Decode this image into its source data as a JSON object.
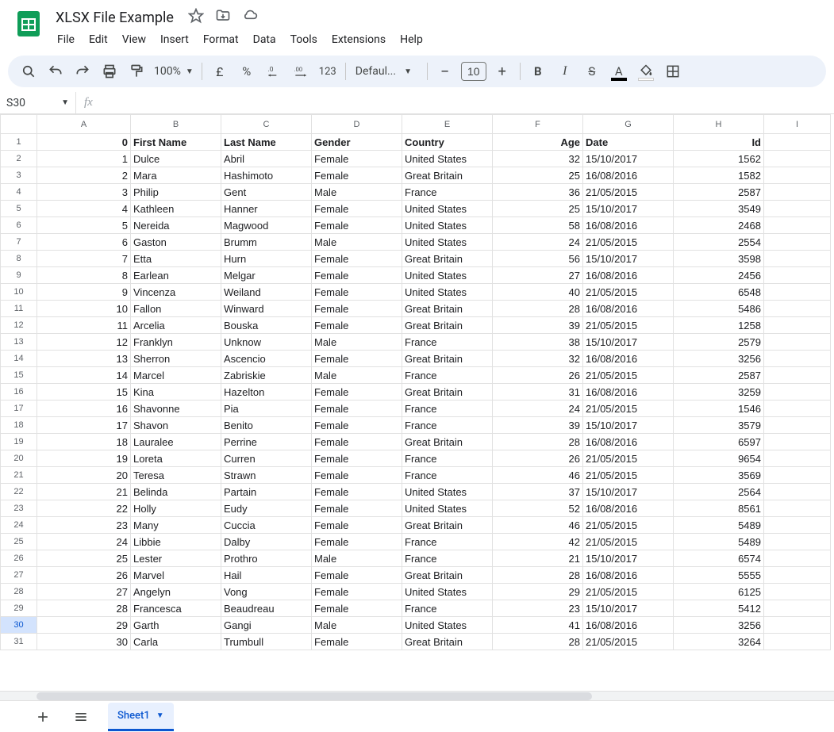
{
  "doc_title": "XLSX File Example",
  "menus": [
    "File",
    "Edit",
    "View",
    "Insert",
    "Format",
    "Data",
    "Tools",
    "Extensions",
    "Help"
  ],
  "toolbar": {
    "zoom": "100%",
    "font": "Defaul...",
    "font_size": "10",
    "currency": "£",
    "percent": "%",
    "num_format": "123"
  },
  "name_box": "S30",
  "columns": [
    "A",
    "B",
    "C",
    "D",
    "E",
    "F",
    "G",
    "H",
    "I"
  ],
  "selected_row": 30,
  "header_row": [
    "0",
    "First Name",
    "Last Name",
    "Gender",
    "Country",
    "Age",
    "Date",
    "Id"
  ],
  "rows": [
    [
      "1",
      "Dulce",
      "Abril",
      "Female",
      "United States",
      "32",
      "15/10/2017",
      "1562"
    ],
    [
      "2",
      "Mara",
      "Hashimoto",
      "Female",
      "Great Britain",
      "25",
      "16/08/2016",
      "1582"
    ],
    [
      "3",
      "Philip",
      "Gent",
      "Male",
      "France",
      "36",
      "21/05/2015",
      "2587"
    ],
    [
      "4",
      "Kathleen",
      "Hanner",
      "Female",
      "United States",
      "25",
      "15/10/2017",
      "3549"
    ],
    [
      "5",
      "Nereida",
      "Magwood",
      "Female",
      "United States",
      "58",
      "16/08/2016",
      "2468"
    ],
    [
      "6",
      "Gaston",
      "Brumm",
      "Male",
      "United States",
      "24",
      "21/05/2015",
      "2554"
    ],
    [
      "7",
      "Etta",
      "Hurn",
      "Female",
      "Great Britain",
      "56",
      "15/10/2017",
      "3598"
    ],
    [
      "8",
      "Earlean",
      "Melgar",
      "Female",
      "United States",
      "27",
      "16/08/2016",
      "2456"
    ],
    [
      "9",
      "Vincenza",
      "Weiland",
      "Female",
      "United States",
      "40",
      "21/05/2015",
      "6548"
    ],
    [
      "10",
      "Fallon",
      "Winward",
      "Female",
      "Great Britain",
      "28",
      "16/08/2016",
      "5486"
    ],
    [
      "11",
      "Arcelia",
      "Bouska",
      "Female",
      "Great Britain",
      "39",
      "21/05/2015",
      "1258"
    ],
    [
      "12",
      "Franklyn",
      "Unknow",
      "Male",
      "France",
      "38",
      "15/10/2017",
      "2579"
    ],
    [
      "13",
      "Sherron",
      "Ascencio",
      "Female",
      "Great Britain",
      "32",
      "16/08/2016",
      "3256"
    ],
    [
      "14",
      "Marcel",
      "Zabriskie",
      "Male",
      "France",
      "26",
      "21/05/2015",
      "2587"
    ],
    [
      "15",
      "Kina",
      "Hazelton",
      "Female",
      "Great Britain",
      "31",
      "16/08/2016",
      "3259"
    ],
    [
      "16",
      "Shavonne",
      "Pia",
      "Female",
      "France",
      "24",
      "21/05/2015",
      "1546"
    ],
    [
      "17",
      "Shavon",
      "Benito",
      "Female",
      "France",
      "39",
      "15/10/2017",
      "3579"
    ],
    [
      "18",
      "Lauralee",
      "Perrine",
      "Female",
      "Great Britain",
      "28",
      "16/08/2016",
      "6597"
    ],
    [
      "19",
      "Loreta",
      "Curren",
      "Female",
      "France",
      "26",
      "21/05/2015",
      "9654"
    ],
    [
      "20",
      "Teresa",
      "Strawn",
      "Female",
      "France",
      "46",
      "21/05/2015",
      "3569"
    ],
    [
      "21",
      "Belinda",
      "Partain",
      "Female",
      "United States",
      "37",
      "15/10/2017",
      "2564"
    ],
    [
      "22",
      "Holly",
      "Eudy",
      "Female",
      "United States",
      "52",
      "16/08/2016",
      "8561"
    ],
    [
      "23",
      "Many",
      "Cuccia",
      "Female",
      "Great Britain",
      "46",
      "21/05/2015",
      "5489"
    ],
    [
      "24",
      "Libbie",
      "Dalby",
      "Female",
      "France",
      "42",
      "21/05/2015",
      "5489"
    ],
    [
      "25",
      "Lester",
      "Prothro",
      "Male",
      "France",
      "21",
      "15/10/2017",
      "6574"
    ],
    [
      "26",
      "Marvel",
      "Hail",
      "Female",
      "Great Britain",
      "28",
      "16/08/2016",
      "5555"
    ],
    [
      "27",
      "Angelyn",
      "Vong",
      "Female",
      "United States",
      "29",
      "21/05/2015",
      "6125"
    ],
    [
      "28",
      "Francesca",
      "Beaudreau",
      "Female",
      "France",
      "23",
      "15/10/2017",
      "5412"
    ],
    [
      "29",
      "Garth",
      "Gangi",
      "Male",
      "United States",
      "41",
      "16/08/2016",
      "3256"
    ],
    [
      "30",
      "Carla",
      "Trumbull",
      "Female",
      "Great Britain",
      "28",
      "21/05/2015",
      "3264"
    ]
  ],
  "sheet_tab": "Sheet1"
}
